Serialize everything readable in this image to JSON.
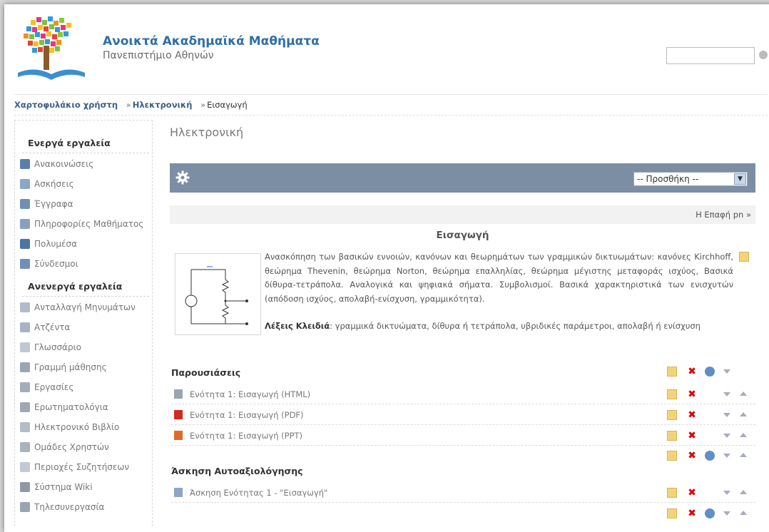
{
  "header": {
    "title": "Ανοικτά Ακαδημαϊκά Μαθήματα",
    "subtitle": "Πανεπιστήμιο Αθηνών"
  },
  "breadcrumb": {
    "items": [
      "Χαρτοφυλάκιο χρήστη",
      "Ηλεκτρονική",
      "Εισαγωγή"
    ],
    "separator": "»"
  },
  "sidebar": {
    "active_heading": "Ενεργά εργαλεία",
    "active_items": [
      {
        "label": "Ανακοινώσεις",
        "icon": "announcement-icon",
        "color": "#5a7fa8"
      },
      {
        "label": "Ασκήσεις",
        "icon": "exercise-icon",
        "color": "#8aa6c8"
      },
      {
        "label": "Έγγραφα",
        "icon": "documents-icon",
        "color": "#6f8fb5"
      },
      {
        "label": "Πληροφορίες Μαθήματος",
        "icon": "tag-icon",
        "color": "#8a9fc0"
      },
      {
        "label": "Πολυμέσα",
        "icon": "multimedia-icon",
        "color": "#4d75a3"
      },
      {
        "label": "Σύνδεσμοι",
        "icon": "links-icon",
        "color": "#6e90b8"
      }
    ],
    "inactive_heading": "Ανενεργά εργαλεία",
    "inactive_items": [
      {
        "label": "Ανταλλαγή Μηνυμάτων",
        "icon": "messages-icon",
        "color": "#b0bcc9"
      },
      {
        "label": "Ατζέντα",
        "icon": "agenda-icon",
        "color": "#a7b4c4"
      },
      {
        "label": "Γλωσσάριο",
        "icon": "glossary-icon",
        "color": "#bfc8d3"
      },
      {
        "label": "Γραμμή μάθησης",
        "icon": "learning-path-icon",
        "color": "#9aa6b4"
      },
      {
        "label": "Εργασίες",
        "icon": "assignments-icon",
        "color": "#a3adba"
      },
      {
        "label": "Ερωτηματολόγια",
        "icon": "questionnaire-icon",
        "color": "#9ea8b5"
      },
      {
        "label": "Ηλεκτρονικό Βιβλίο",
        "icon": "ebook-icon",
        "color": "#b4bcc6"
      },
      {
        "label": "Ομάδες Χρηστών",
        "icon": "user-groups-icon",
        "color": "#aab2bd"
      },
      {
        "label": "Περιοχές Συζητήσεων",
        "icon": "forum-icon",
        "color": "#c3cad3"
      },
      {
        "label": "Σύστημα Wiki",
        "icon": "wiki-icon",
        "color": "#8f98a4"
      },
      {
        "label": "Τηλεσυνεργασία",
        "icon": "teleconference-icon",
        "color": "#9aa4b0"
      }
    ]
  },
  "main": {
    "course_title": "Ηλεκτρονική",
    "add_select_value": "-- Προσθήκη --",
    "next_link": "Η Επαφή pn »",
    "unit_title": "Εισαγωγή",
    "description": "Ανασκόπηση των βασικών εννοιών, κανόνων και θεωρημάτων των γραμμικών δικτυωμάτων: κανόνες Kirchhoff, θεώρημα Thevenin, θεώρημα Norton, θεώρημα επαλληλίας, θεώρημα μέγιστης μεταφοράς ισχύος, Βασικά δίθυρα-τετράπολα. Αναλογικά και ψηφιακά σήματα. Συμβολισμοί. Βασικά χαρακτηριστικά των ενισχυτών (απόδοση ισχύος, απολαβή-ενίσχυση, γραμμικότητα).",
    "keywords_label": "Λέξεις Κλειδιά",
    "keywords": ": γραμμικά δικτυώματα, δίθυρα ή τετράπολα, υβριδικές παράμετροι, απολαβή ή ενίσχυση",
    "sections": [
      {
        "title": "Παρουσιάσεις",
        "rows": [
          {
            "name": "Ενότητα 1: Εισαγωγή (HTML)",
            "icon": "html-file-icon",
            "color": "#9aa3ae"
          },
          {
            "name": "Ενότητα 1: Εισαγωγή (PDF)",
            "icon": "pdf-file-icon",
            "color": "#d02a1e"
          },
          {
            "name": "Ενότητα 1: Εισαγωγή (PPT)",
            "icon": "ppt-file-icon",
            "color": "#e06a2a"
          }
        ]
      },
      {
        "title": "Άσκηση Αυτοαξιολόγησης",
        "rows": [
          {
            "name": "Άσκηση Ενότητας 1 - \"Εισαγωγή\"",
            "icon": "exercise-icon",
            "color": "#8aa6c8"
          }
        ]
      }
    ]
  }
}
